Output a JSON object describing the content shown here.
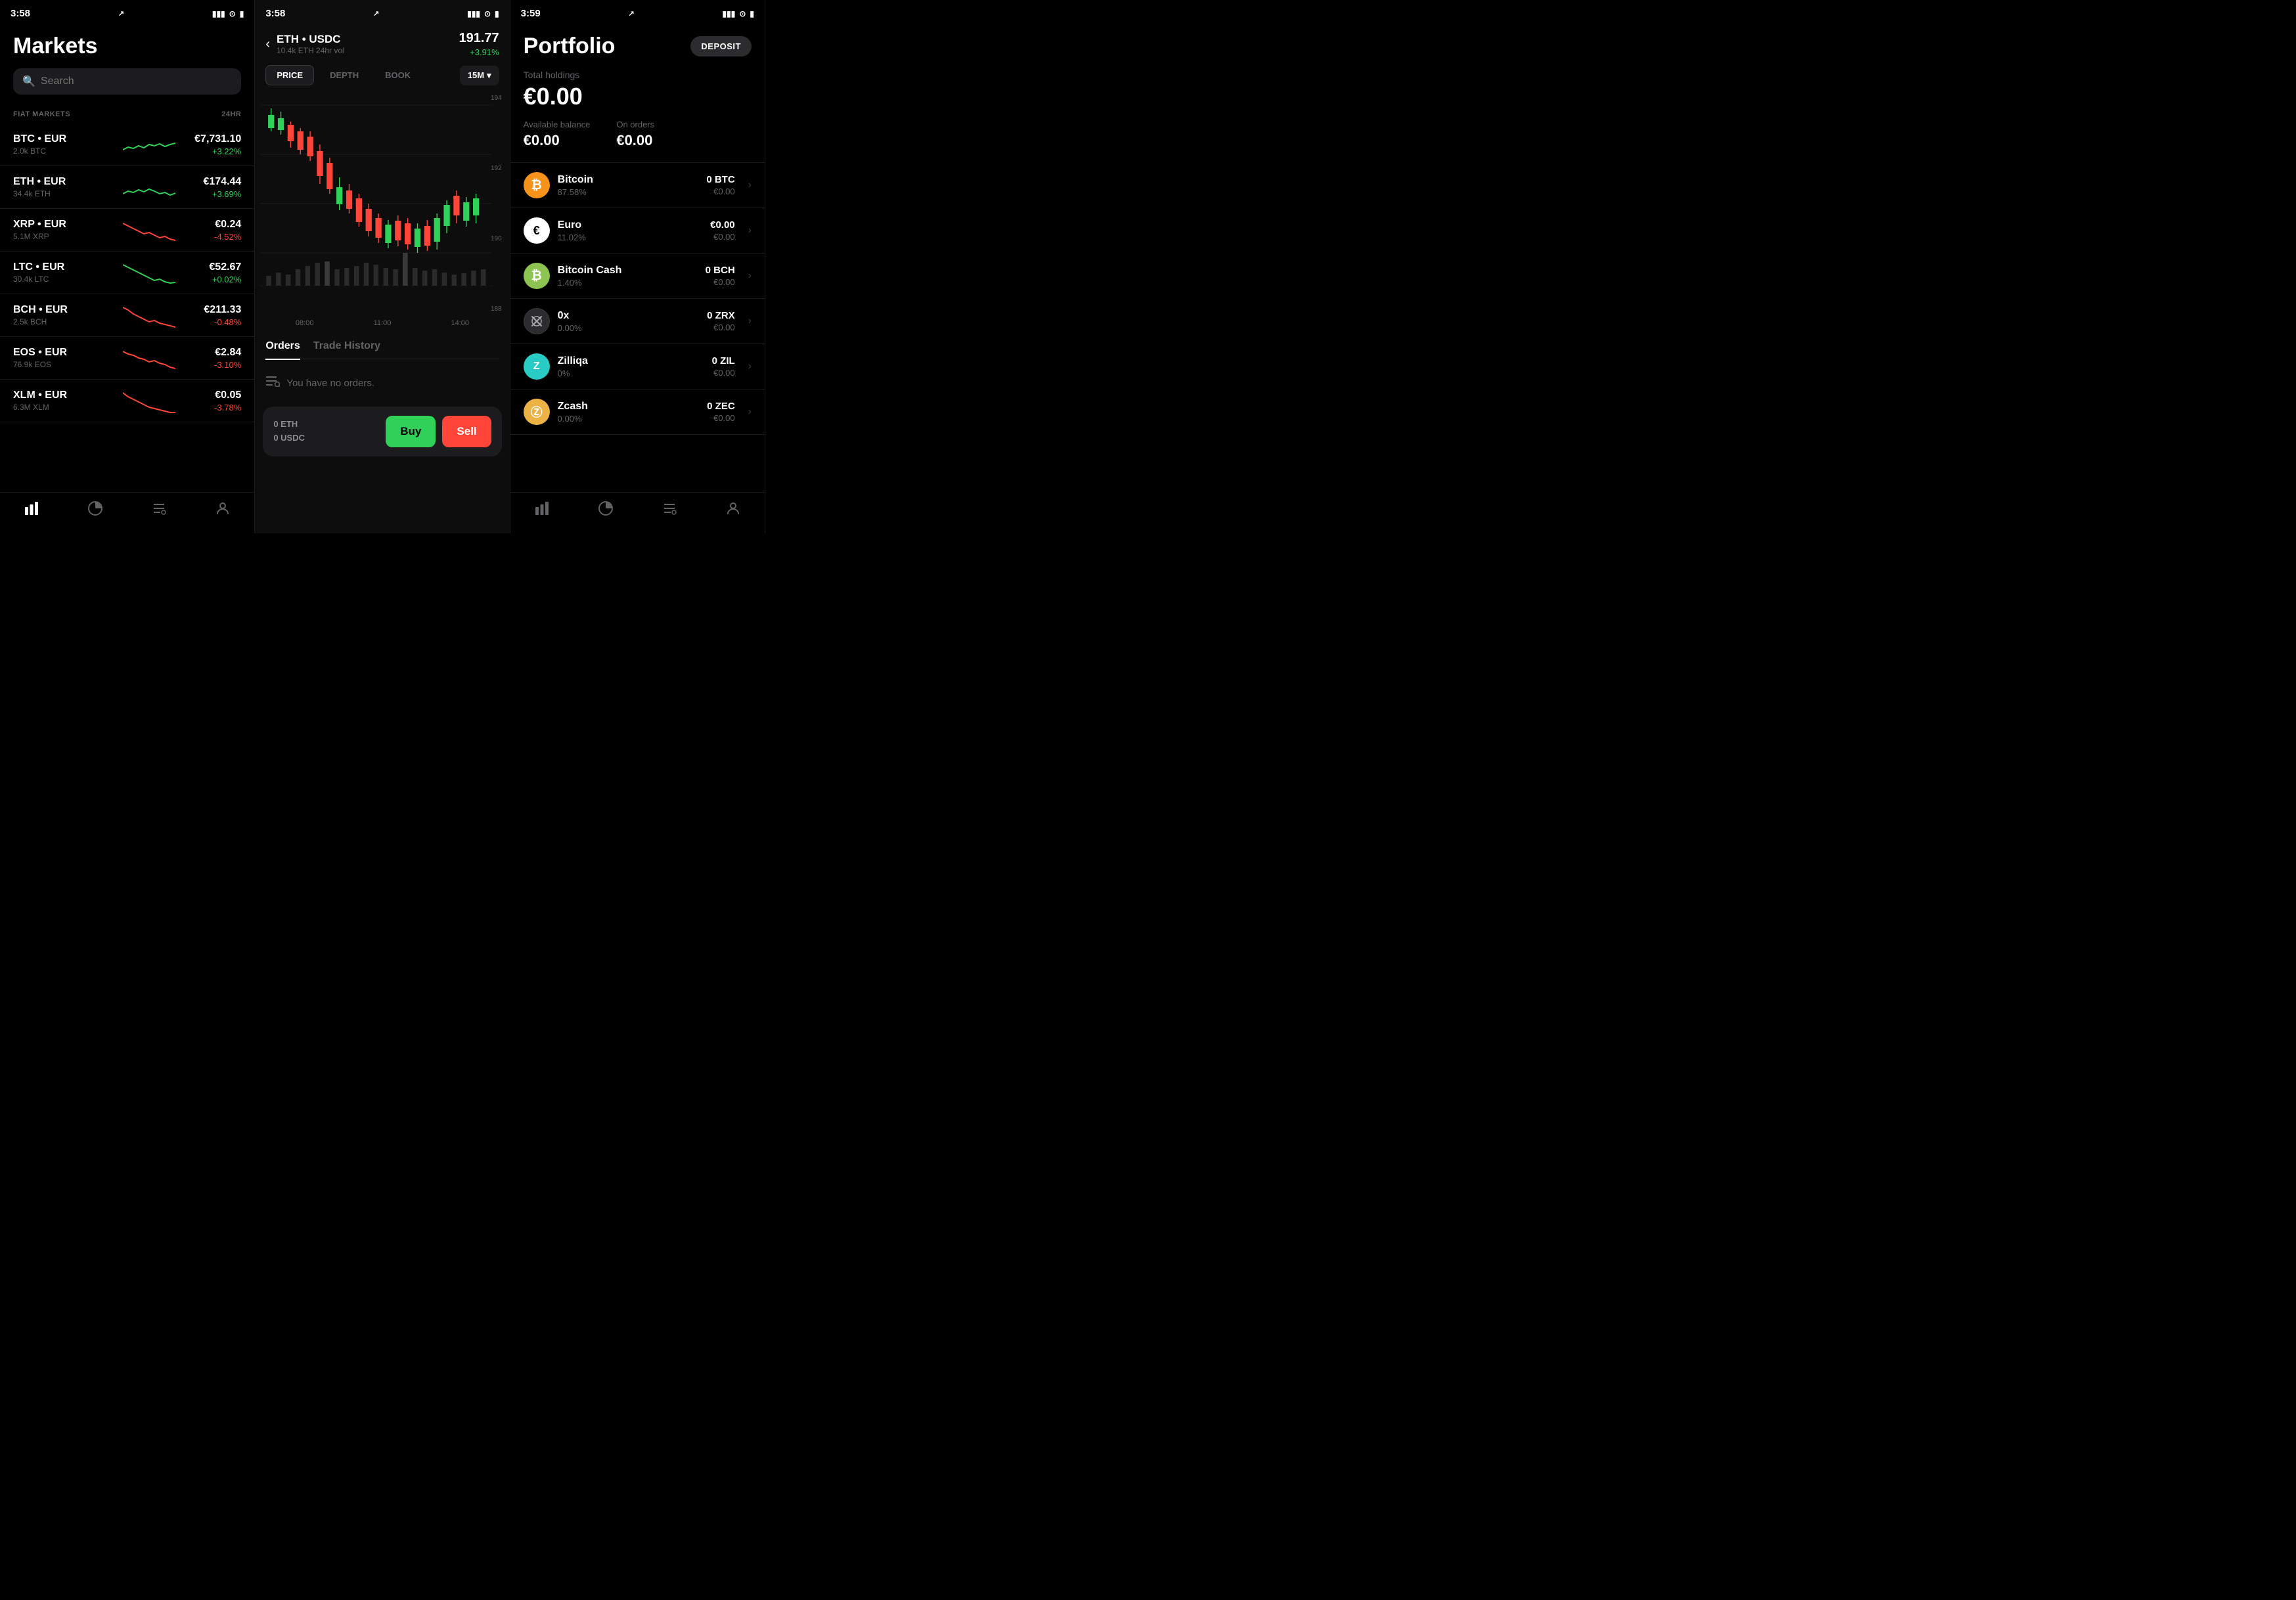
{
  "panels": {
    "markets": {
      "status": {
        "time": "3:58",
        "arrow": "↗"
      },
      "title": "Markets",
      "search": {
        "placeholder": "Search"
      },
      "section_label": "FIAT MARKETS",
      "section_24hr": "24HR",
      "items": [
        {
          "pair": "BTC • EUR",
          "vol": "2.0k BTC",
          "price": "€7,731.10",
          "change": "+3.22%",
          "positive": true
        },
        {
          "pair": "ETH • EUR",
          "vol": "34.4k ETH",
          "price": "€174.44",
          "change": "+3.69%",
          "positive": true
        },
        {
          "pair": "XRP • EUR",
          "vol": "5.1M XRP",
          "price": "€0.24",
          "change": "-4.52%",
          "positive": false
        },
        {
          "pair": "LTC • EUR",
          "vol": "30.4k LTC",
          "price": "€52.67",
          "change": "+0.02%",
          "positive": true
        },
        {
          "pair": "BCH • EUR",
          "vol": "2.5k BCH",
          "price": "€211.33",
          "change": "-0.48%",
          "positive": false
        },
        {
          "pair": "EOS • EUR",
          "vol": "76.9k EOS",
          "price": "€2.84",
          "change": "-3.10%",
          "positive": false
        },
        {
          "pair": "XLM • EUR",
          "vol": "6.3M XLM",
          "price": "€0.05",
          "change": "-3.78%",
          "positive": false
        }
      ],
      "nav": {
        "items": [
          "markets",
          "portfolio-pie",
          "orders-list",
          "profile"
        ]
      }
    },
    "chart": {
      "status": {
        "time": "3:58",
        "arrow": "↗"
      },
      "pair_title": "ETH • USDC",
      "vol": "10.4k ETH 24hr vol",
      "current_price": "191.77",
      "price_change": "+3.91%",
      "tabs": [
        "PRICE",
        "DEPTH",
        "BOOK"
      ],
      "active_tab": "PRICE",
      "timeframe": "15M",
      "y_labels": [
        "194",
        "192",
        "190",
        "188"
      ],
      "x_labels": [
        "08:00",
        "11:00",
        "14:00"
      ],
      "orders_tab_active": "Orders",
      "orders_tab_inactive": "Trade History",
      "no_orders_text": "You have no orders.",
      "trade": {
        "eth_balance": "0 ETH",
        "usdc_balance": "0 USDC",
        "buy_label": "Buy",
        "sell_label": "Sell"
      }
    },
    "portfolio": {
      "status": {
        "time": "3:59",
        "arrow": "↗"
      },
      "title": "Portfolio",
      "deposit_label": "DEPOSIT",
      "total_holdings_label": "Total holdings",
      "total_holdings_value": "€0.00",
      "available_balance_label": "Available balance",
      "available_balance_value": "€0.00",
      "on_orders_label": "On orders",
      "on_orders_value": "€0.00",
      "assets": [
        {
          "name": "Bitcoin",
          "pct": "87.58%",
          "amount": "0 BTC",
          "eur": "€0.00",
          "icon_type": "btc",
          "icon_text": "₿"
        },
        {
          "name": "Euro",
          "pct": "11.02%",
          "amount": "€0.00",
          "eur": "€0.00",
          "icon_type": "eur",
          "icon_text": "€"
        },
        {
          "name": "Bitcoin Cash",
          "pct": "1.40%",
          "amount": "0 BCH",
          "eur": "€0.00",
          "icon_type": "bch",
          "icon_text": "₿"
        },
        {
          "name": "0x",
          "pct": "0.00%",
          "amount": "0 ZRX",
          "eur": "€0.00",
          "icon_type": "zrx",
          "icon_text": "✕"
        },
        {
          "name": "Zilliqa",
          "pct": "0%",
          "amount": "0 ZIL",
          "eur": "€0.00",
          "icon_type": "zil",
          "icon_text": "Z"
        },
        {
          "name": "Zcash",
          "pct": "0.00%",
          "amount": "0 ZEC",
          "eur": "€0.00",
          "icon_type": "zec",
          "icon_text": "ⓩ"
        }
      ]
    }
  }
}
